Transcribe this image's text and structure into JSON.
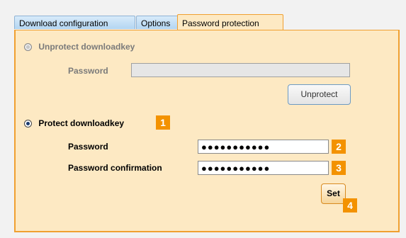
{
  "tabs": [
    {
      "label": "Download configuration"
    },
    {
      "label": "Options"
    },
    {
      "label": "Password protection"
    }
  ],
  "unprotect": {
    "option_label": "Unprotect downloadkey",
    "password_label": "Password",
    "password_value": "",
    "button_label": "Unprotect"
  },
  "protect": {
    "option_label": "Protect downloadkey",
    "password_label": "Password",
    "password_value": "●●●●●●●●●●●",
    "confirm_label": "Password confirmation",
    "confirm_value": "●●●●●●●●●●●",
    "button_label": "Set"
  },
  "badges": [
    "1",
    "2",
    "3",
    "4"
  ],
  "colors": {
    "accent": "#f39200",
    "panel": "#fde9c3",
    "tab": "#c6e0f5"
  }
}
